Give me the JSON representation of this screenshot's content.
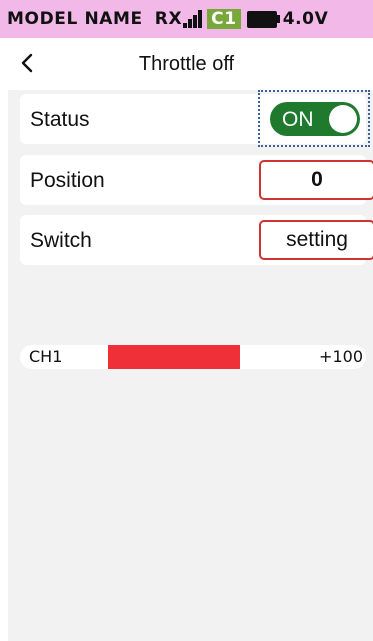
{
  "status_bar": {
    "model_name": "MODEL NAME",
    "rx_label": "RX",
    "channel_badge": "C1",
    "voltage": "4.0V"
  },
  "header": {
    "title": "Throttle off"
  },
  "settings": {
    "status": {
      "label": "Status",
      "toggle_text": "ON"
    },
    "position": {
      "label": "Position",
      "value": "0"
    },
    "switch": {
      "label": "Switch",
      "value": "setting"
    }
  },
  "channel": {
    "label": "CH1",
    "value_text": "+100",
    "level": 1.0
  },
  "colors": {
    "status_bar_bg": "#f2b8e8",
    "badge_green": "#79a83a",
    "toggle_green": "#1f7a2e",
    "accent_red": "#f03039",
    "box_border_red": "#cc3333",
    "focus_blue": "#3b5f9f"
  },
  "icons": {
    "back": "chevron-left-icon",
    "signal": "signal-bars-icon",
    "battery": "battery-icon"
  }
}
